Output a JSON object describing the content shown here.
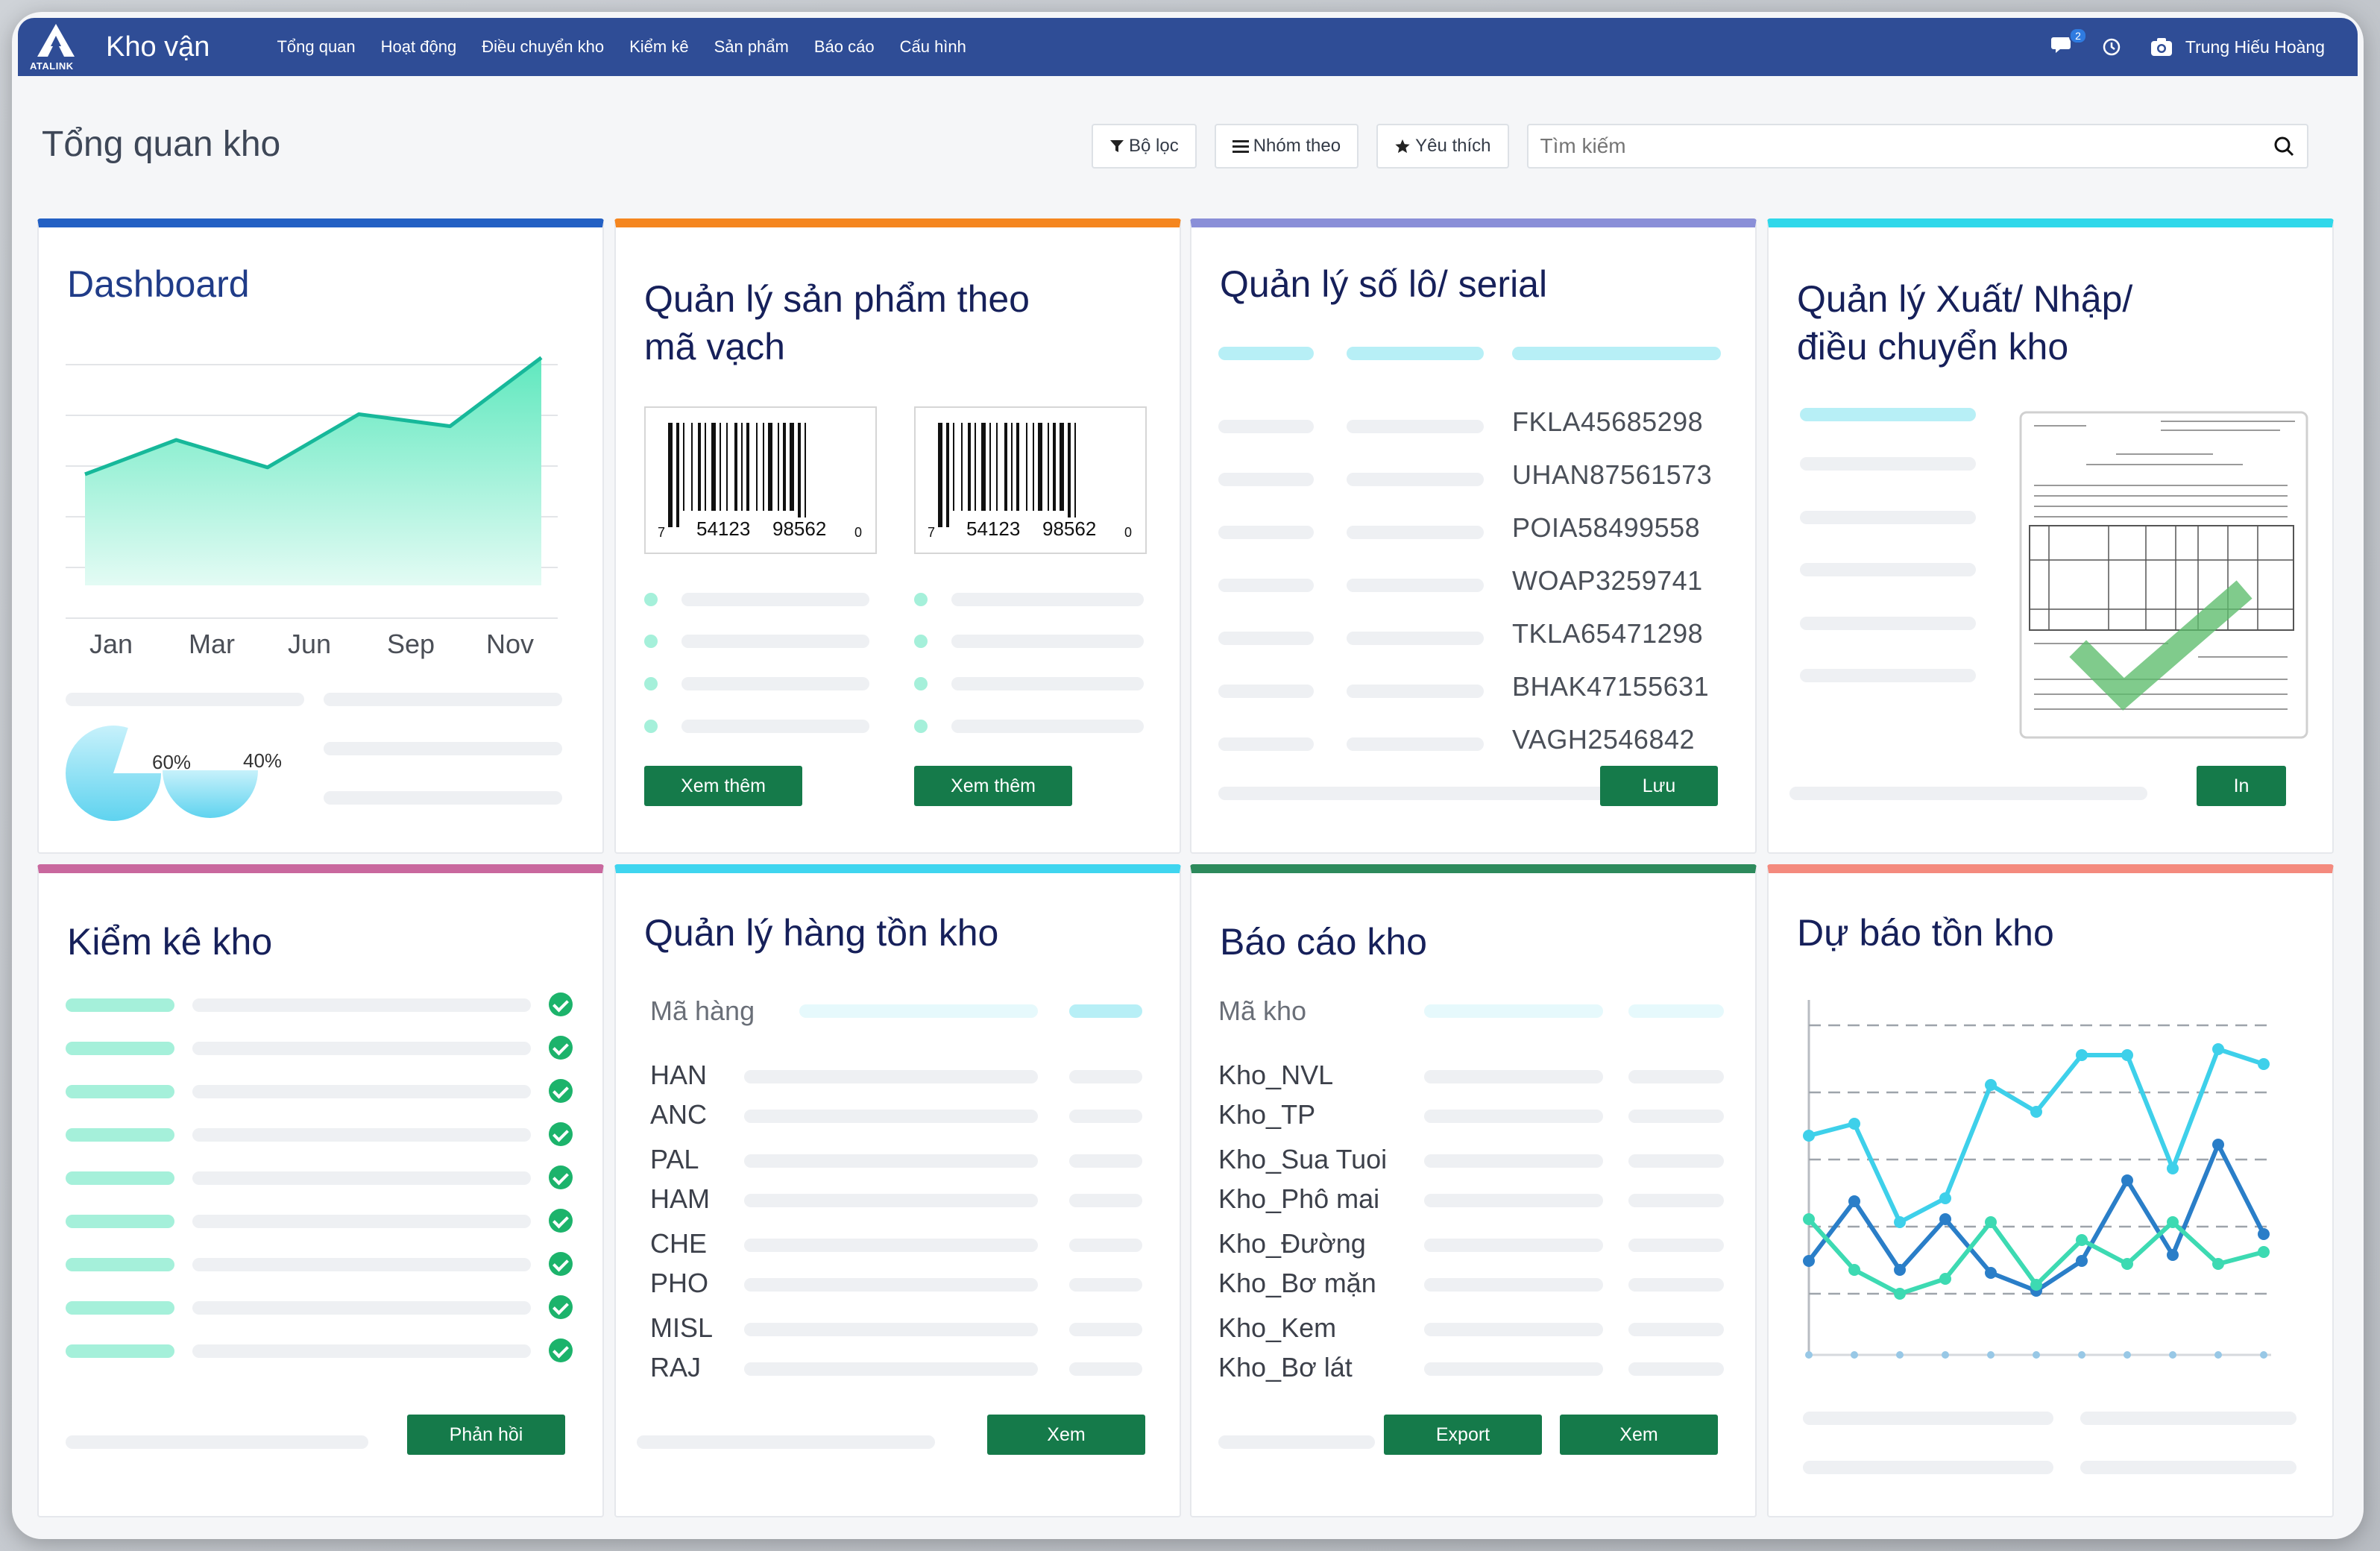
{
  "nav": {
    "logo_text": "ATALINK",
    "app_title": "Kho vận",
    "menu": [
      "Tổng quan",
      "Hoạt động",
      "Điều chuyển kho",
      "Kiểm kê",
      "Sản phẩm",
      "Báo cáo",
      "Cấu hình"
    ],
    "chat_badge": "2",
    "user_name": "Trung Hiếu Hoàng"
  },
  "page": {
    "title": "Tổng quan kho",
    "filter_label": "Bộ lọc",
    "group_label": "Nhóm theo",
    "favorite_label": "Yêu thích",
    "search_placeholder": "Tìm kiếm"
  },
  "cards": {
    "dashboard": {
      "title": "Dashboard",
      "months": [
        "Jan",
        "Mar",
        "Jun",
        "Sep",
        "Nov"
      ],
      "pie_labels": [
        "60%",
        "40%"
      ]
    },
    "barcode": {
      "title_line1": "Quản lý sản phẩm theo",
      "title_line2": "mã vạch",
      "barcode_left": "7",
      "barcode_mid1": "54123",
      "barcode_mid2": "98562",
      "barcode_right": "0",
      "btn1": "Xem thêm",
      "btn2": "Xem thêm"
    },
    "serial": {
      "title": "Quản lý số lô/ serial",
      "codes": [
        "FKLA45685298",
        "UHAN87561573",
        "POIA58499558",
        "WOAP3259741",
        "TKLA65471298",
        "BHAK47155631",
        "VAGH2546842"
      ],
      "btn": "Lưu"
    },
    "transfer": {
      "title_line1": "Quản lý Xuất/ Nhập/",
      "title_line2": "điều chuyển kho",
      "btn": "In"
    },
    "stocktake": {
      "title": "Kiểm kê kho",
      "btn": "Phản hồi"
    },
    "inventory": {
      "title": "Quản lý hàng tồn kho",
      "column_header": "Mã hàng",
      "items": [
        "HAN",
        "ANC",
        "PAL",
        "HAM",
        "CHE",
        "PHO",
        "MISL",
        "RAJ"
      ],
      "btn": "Xem"
    },
    "report": {
      "title": "Báo cáo kho",
      "column_header": "Mã kho",
      "items": [
        "Kho_NVL",
        "Kho_TP",
        "Kho_Sua Tuoi",
        "Kho_Phô mai",
        "Kho_Đường",
        "Kho_Bơ mặn",
        "Kho_Kem",
        "Kho_Bơ lát"
      ],
      "btn_export": "Export",
      "btn_view": "Xem"
    },
    "forecast": {
      "title": "Dự báo tồn kho"
    }
  },
  "colors": {
    "nav_bg": "#2f4d96",
    "button_green": "#157a4a",
    "accent_dashboard": "#2360c4",
    "accent_barcode": "#f5861f",
    "accent_serial": "#8a8fd8",
    "accent_transfer": "#2fd8ea",
    "accent_stocktake": "#c9689e",
    "accent_inventory": "#3fd5ef",
    "accent_report": "#2d8a5c",
    "accent_forecast": "#f48a7e"
  },
  "chart_data": [
    {
      "type": "area",
      "categories": [
        "Jan",
        "Mar",
        "Jun",
        "Sep",
        "Nov"
      ],
      "values": [
        30,
        50,
        34,
        65,
        58,
        98
      ],
      "ylim": [
        0,
        100
      ],
      "grid": true
    },
    {
      "type": "pie",
      "labels": [
        "60%",
        "40%"
      ],
      "values": [
        60,
        40
      ]
    },
    {
      "type": "line",
      "x": [
        1,
        2,
        3,
        4,
        5,
        6,
        7,
        8,
        9,
        10,
        11
      ],
      "series": [
        {
          "color": "#3ed0ea",
          "values": [
            62,
            66,
            33,
            41,
            79,
            70,
            89,
            89,
            51,
            91,
            86
          ]
        },
        {
          "color": "#2a7ec8",
          "values": [
            20,
            40,
            17,
            34,
            16,
            10,
            20,
            47,
            22,
            59,
            29
          ]
        },
        {
          "color": "#3ddab2",
          "values": [
            34,
            17,
            9,
            14,
            33,
            12,
            27,
            19,
            33,
            19,
            23
          ]
        }
      ],
      "grid": true
    }
  ]
}
